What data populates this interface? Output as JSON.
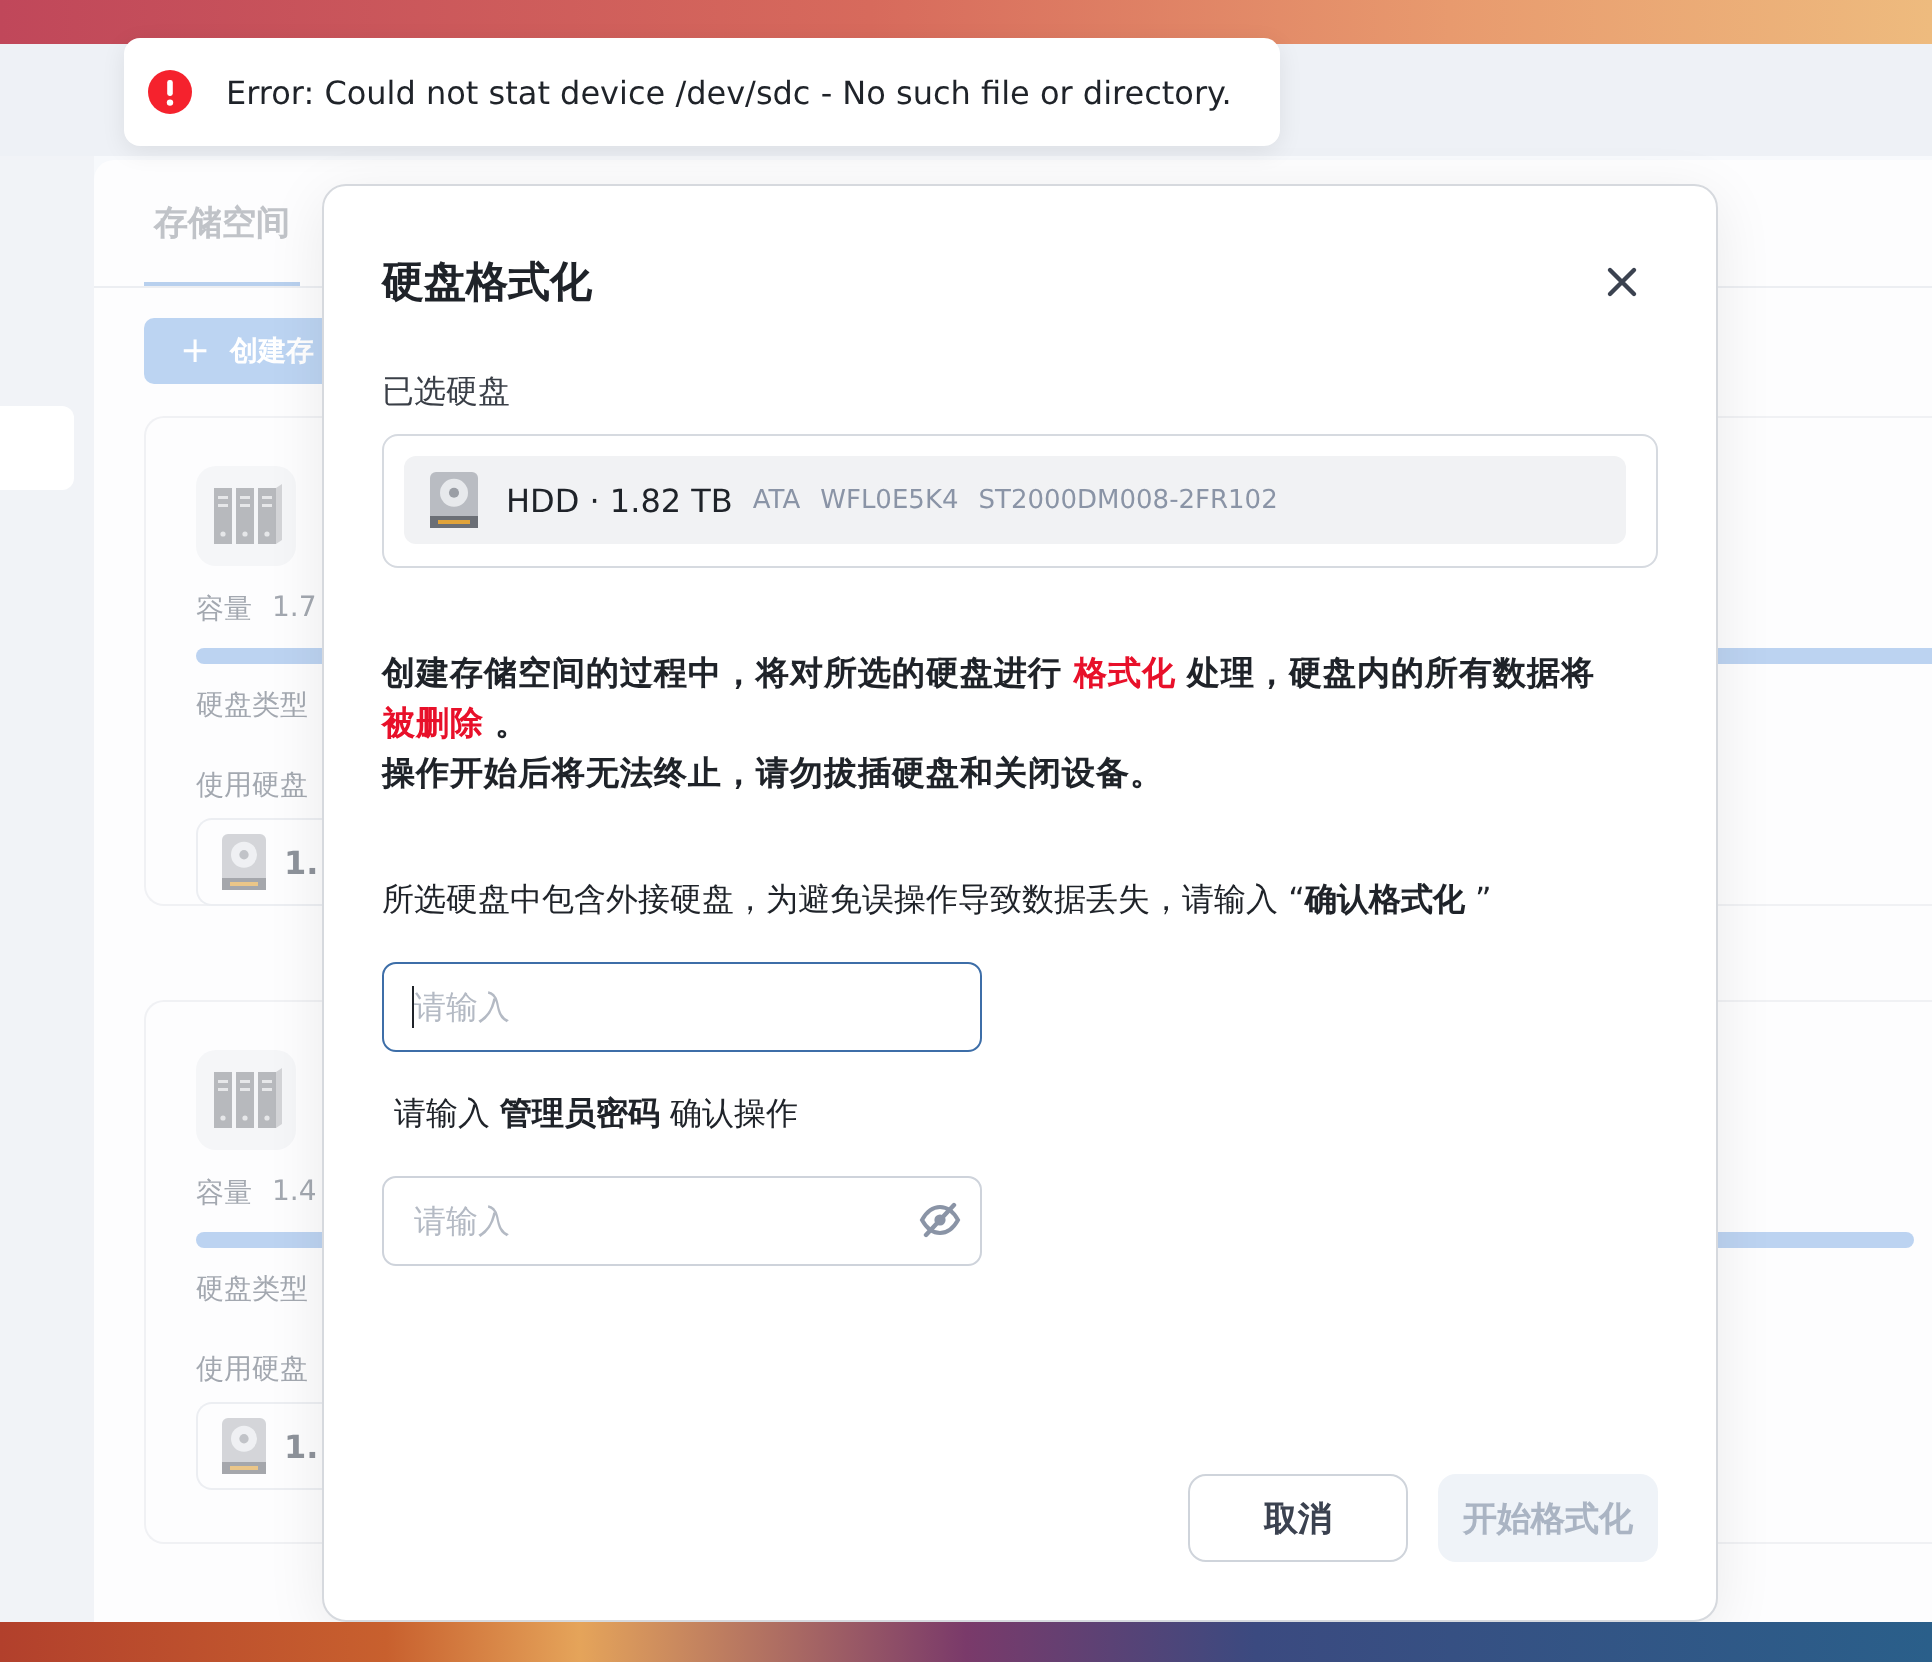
{
  "toast": {
    "kind": "error",
    "message": "Error: Could not stat device /dev/sdc - No such file or directory."
  },
  "background": {
    "sidebar_items": [
      {
        "selected": true
      }
    ],
    "tabs": [
      {
        "label": "存储空间",
        "selected": true
      }
    ],
    "create_button": {
      "icon": "+",
      "label": "创建存"
    },
    "cards": [
      {
        "capacity_label": "容量",
        "capacity_value": "1.7",
        "disk_type_label": "硬盘类型",
        "disks_label": "使用硬盘",
        "disk_value": "1."
      },
      {
        "capacity_label": "容量",
        "capacity_value": "1.4",
        "disk_type_label": "硬盘类型",
        "disks_label": "使用硬盘",
        "disk_value": "1."
      }
    ]
  },
  "dialog": {
    "title": "硬盘格式化",
    "selected_label": "已选硬盘",
    "disks": [
      {
        "name": "HDD · 1.82 TB",
        "details": [
          "ATA",
          "WFL0E5K4",
          "ST2000DM008-2FR102"
        ]
      }
    ],
    "warning": [
      [
        {
          "text": "创建存储空间的过程中，将对所选的硬盘进行 ",
          "danger": false
        },
        {
          "text": "格式化",
          "danger": true
        },
        {
          "text": " 处理，硬盘内的所有数据将 ",
          "danger": false
        },
        {
          "text": "被删除",
          "danger": true
        },
        {
          "text": " 。",
          "danger": false
        }
      ],
      [
        {
          "text": "操作开始后将无法终止，请勿拔插硬盘和关闭设备。",
          "danger": false
        }
      ]
    ],
    "fields": [
      {
        "label": "所选硬盘中包含外接硬盘，为避免误操作导致数据丢失，请输入 “**确认格式化** ”",
        "placeholder": "请输入",
        "focused": true,
        "kind": "text"
      },
      {
        "label": "请输入 **管理员密码** 确认操作",
        "placeholder": "请输入",
        "focused": false,
        "kind": "password"
      }
    ],
    "buttons": [
      {
        "label": "取消",
        "kind": "secondary",
        "disabled": false
      },
      {
        "label": "开始格式化",
        "kind": "primary",
        "disabled": true
      }
    ]
  }
}
